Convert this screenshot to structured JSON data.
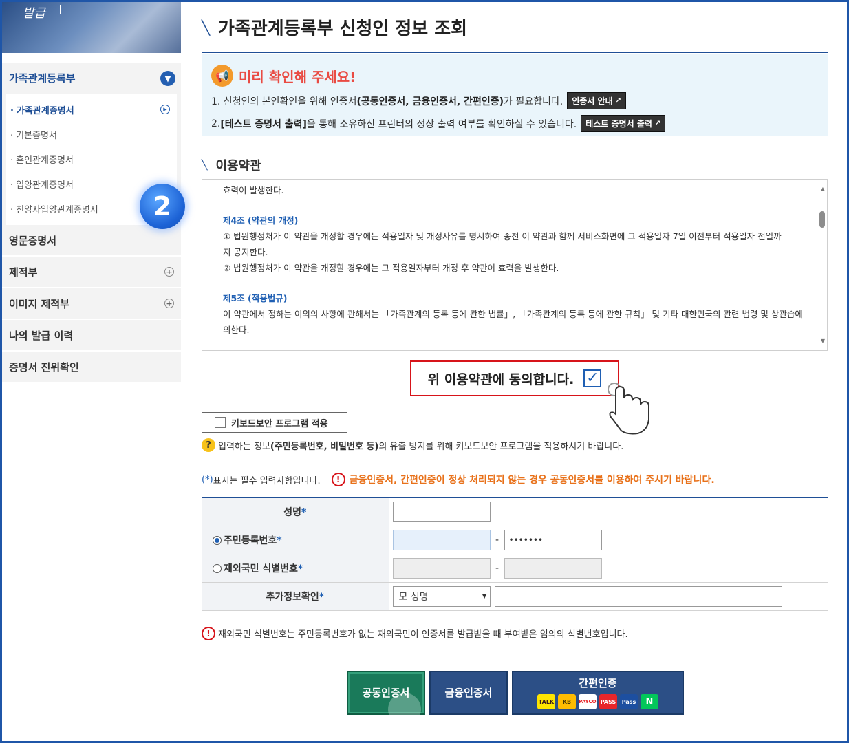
{
  "sidebar": {
    "banner_text": "발급",
    "group_title": "가족관계등록부",
    "sub_items": [
      {
        "label": "가족관계증명서",
        "active": true
      },
      {
        "label": "기본증명서",
        "active": false
      },
      {
        "label": "혼인관계증명서",
        "active": false
      },
      {
        "label": "입양관계증명서",
        "active": false
      },
      {
        "label": "친양자입양관계증명서",
        "active": false
      }
    ],
    "main_items": [
      {
        "label": "영문증명서",
        "expandable": false
      },
      {
        "label": "제적부",
        "expandable": true
      },
      {
        "label": "이미지 제적부",
        "expandable": true
      },
      {
        "label": "나의 발급 이력",
        "expandable": false
      },
      {
        "label": "증명서 진위확인",
        "expandable": false
      }
    ],
    "step_badge": "2"
  },
  "page": {
    "title": "가족관계등록부 신청인 정보 조회"
  },
  "notice": {
    "title": "미리 확인해 주세요!",
    "line1_prefix": "1. 신청인의 본인확인을 위해 인증서",
    "line1_bold": "(공동인증서, 금융인증서, 간편인증)",
    "line1_suffix": "가 필요합니다.",
    "line1_button": "인증서 안내",
    "line2_prefix": "2. ",
    "line2_bold": "[테스트 증명서 출력]",
    "line2_suffix": "을 통해 소유하신 프린터의 정상 출력 여부를 확인하실 수 있습니다.",
    "line2_button": "테스트 증명서 출력"
  },
  "terms": {
    "section_title": "이용약관",
    "line0": "효력이 발생한다.",
    "art4_title": "제4조 (약관의 개정)",
    "art4_p1": "① 법원행정처가 이 약관을 개정할 경우에는 적용일자 및 개정사유를 명시하여 종전 이 약관과 함께 서비스화면에 그 적용일자 7일 이전부터 적용일자 전일까",
    "art4_p1b": "지 공지한다.",
    "art4_p2": "② 법원행정처가 이 약관을 개정할 경우에는 그 적용일자부터 개정 후 약관이 효력을 발생한다.",
    "art5_title": "제5조 (적용법규)",
    "art5_p1": "이 약관에서 정하는 이외의 사항에 관해서는 「가족관계의 등록 등에 관한 법률」, 「가족관계의 등록 등에 관한 규칙」 및 기타 대한민국의 관련 법령 및 상관습에",
    "art5_p1b": "의한다.",
    "agree_label": "위 이용약관에 동의합니다.",
    "agreed": true
  },
  "keyboard": {
    "button_label": "키보드보안 프로그램 적용",
    "note_prefix": "입력하는 정보",
    "note_bold": "(주민등록번호, 비밀번호 등)",
    "note_suffix": "의 유출 방지를 위해 키보드보안 프로그램을 적용하시기 바랍니다."
  },
  "required": {
    "marker": "(*)",
    "text": "표시는 필수 입력사항입니다.",
    "warning": "금융인증서, 간편인증이 정상 처리되지 않는 경우 공동인증서를 이용하여 주시기 바랍니다."
  },
  "form": {
    "name_label": "성명",
    "rrn_label": "주민등록번호",
    "rrn_back_value": "•••••••",
    "foreign_label": "재외국민 식별번호",
    "extra_label": "추가정보확인",
    "extra_select": "모 성명",
    "star": "*",
    "dash": "-",
    "note": "재외국민 식별번호는 주민등록번호가 없는 재외국민이 인증서를 발급받을 때 부여받은 임의의 식별번호입니다."
  },
  "buttons": {
    "public_cert": "공동인증서",
    "financial_cert": "금융인증서",
    "simple_auth": "간편인증",
    "simple_icons": [
      "TALK",
      "KB",
      "PAYCO",
      "PASS",
      "Pass",
      "N"
    ]
  },
  "colors": {
    "accent": "#1f4f96",
    "alert": "#e94b43",
    "warning": "#e8711a",
    "green_button": "#1a7a5a"
  }
}
